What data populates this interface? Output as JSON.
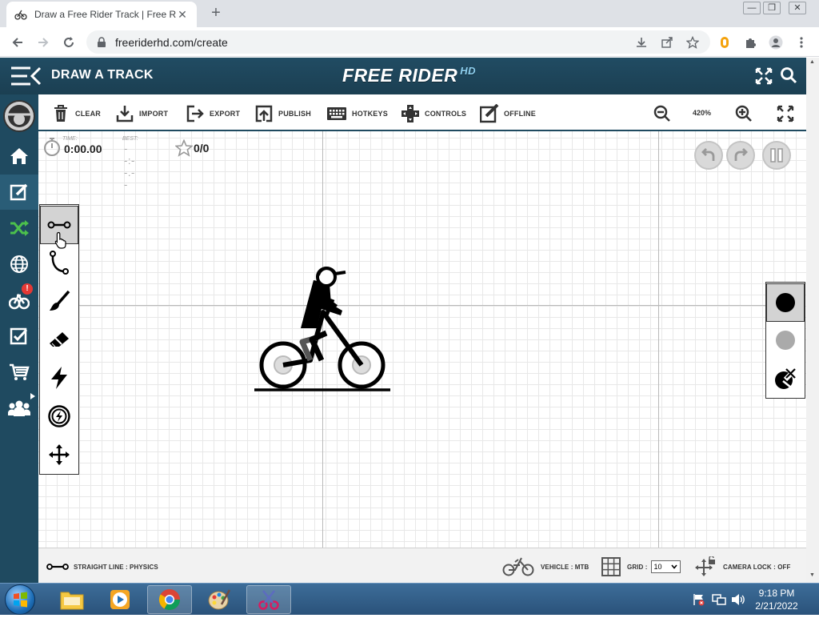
{
  "browser": {
    "tab_title": "Draw a Free Rider Track | Free Rid",
    "tab_close": "✕",
    "new_tab": "+",
    "url": "freeriderhd.com/create",
    "window_buttons": [
      "—",
      "❐",
      "✕"
    ]
  },
  "header": {
    "page_title": "DRAW A TRACK",
    "logo_text": "FREE RIDER",
    "logo_hd": "HD"
  },
  "leftnav": {
    "items": [
      "home-icon",
      "editor-icon",
      "random-icon",
      "globe-icon",
      "achievements-icon",
      "checklist-icon",
      "shop-icon",
      "friends-icon"
    ],
    "active": "editor-icon",
    "badge": "!"
  },
  "toolbar": {
    "clear": "CLEAR",
    "import": "IMPORT",
    "export": "EXPORT",
    "publish": "PUBLISH",
    "hotkeys": "HOTKEYS",
    "controls": "CONTROLS",
    "offline": "OFFLINE",
    "zoom": "420%"
  },
  "hud": {
    "time_label": "TIME:",
    "time": "0:00.00",
    "best_label": "BEST:",
    "best": "--:--.--",
    "stars": "0/0"
  },
  "tools": [
    "straight-line-tool",
    "curve-tool",
    "brush-tool",
    "eraser-tool",
    "powerup-tool",
    "vehicle-powerup-tool",
    "camera-move-tool"
  ],
  "active_tool": "straight-line-tool",
  "line_types": [
    "physics-line",
    "scenery-line",
    "erase-line-type"
  ],
  "active_line_type": "physics-line",
  "colors": {
    "header": "#1f4a60",
    "physics_line": "#000000",
    "scenery_line": "#aaaaaa"
  },
  "status": {
    "tool_label": "STRAIGHT LINE : PHYSICS",
    "vehicle_label": "VEHICLE : MTB",
    "grid_label": "GRID :",
    "grid_value": "10",
    "camera_label": "CAMERA LOCK : OFF"
  },
  "taskbar": {
    "time": "9:18 PM",
    "date": "2/21/2022"
  }
}
